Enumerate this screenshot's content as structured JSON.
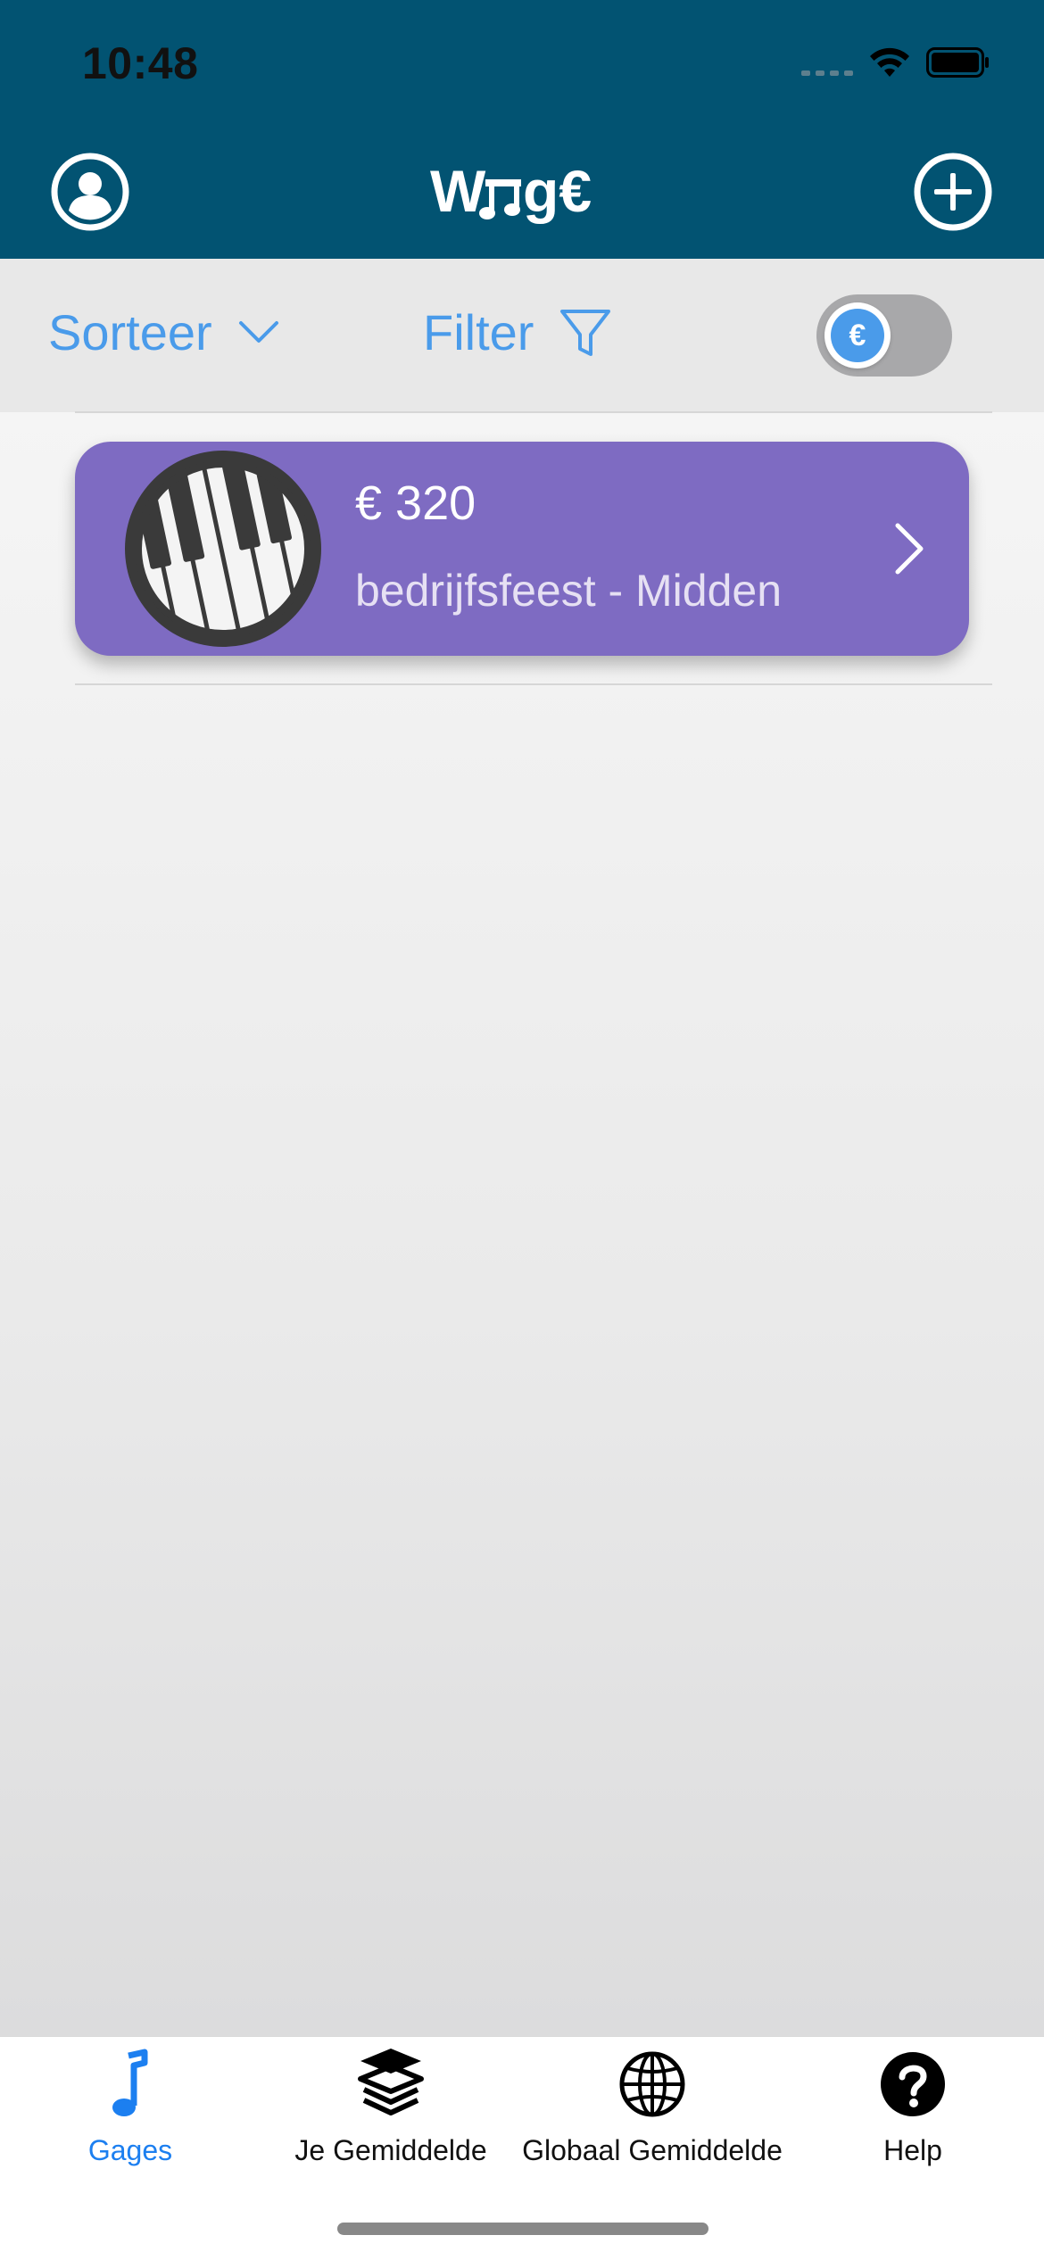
{
  "status_bar": {
    "time": "10:48"
  },
  "header": {
    "logo_text": "Wag€",
    "profile_icon": "person-circle-icon",
    "add_icon": "plus-circle-icon",
    "background": "#025372"
  },
  "toolbar": {
    "sort_label": "Sorteer",
    "filter_label": "Filter",
    "toggle_symbol": "€",
    "toggle_on": false,
    "accent": "#4a9bea"
  },
  "items": [
    {
      "amount": "€ 320",
      "subtitle": "bedrijfsfeest - Midden",
      "icon": "piano-keys-icon",
      "color": "#7e6bc2"
    }
  ],
  "tabbar": {
    "tabs": [
      {
        "label": "Gages",
        "icon": "music-note-icon",
        "active": true
      },
      {
        "label": "Je Gemiddelde",
        "icon": "layers-icon",
        "active": false
      },
      {
        "label": "Globaal Gemiddelde",
        "icon": "globe-icon",
        "active": false
      },
      {
        "label": "Help",
        "icon": "question-circle-icon",
        "active": false
      }
    ],
    "active_color": "#1c7ff0"
  }
}
